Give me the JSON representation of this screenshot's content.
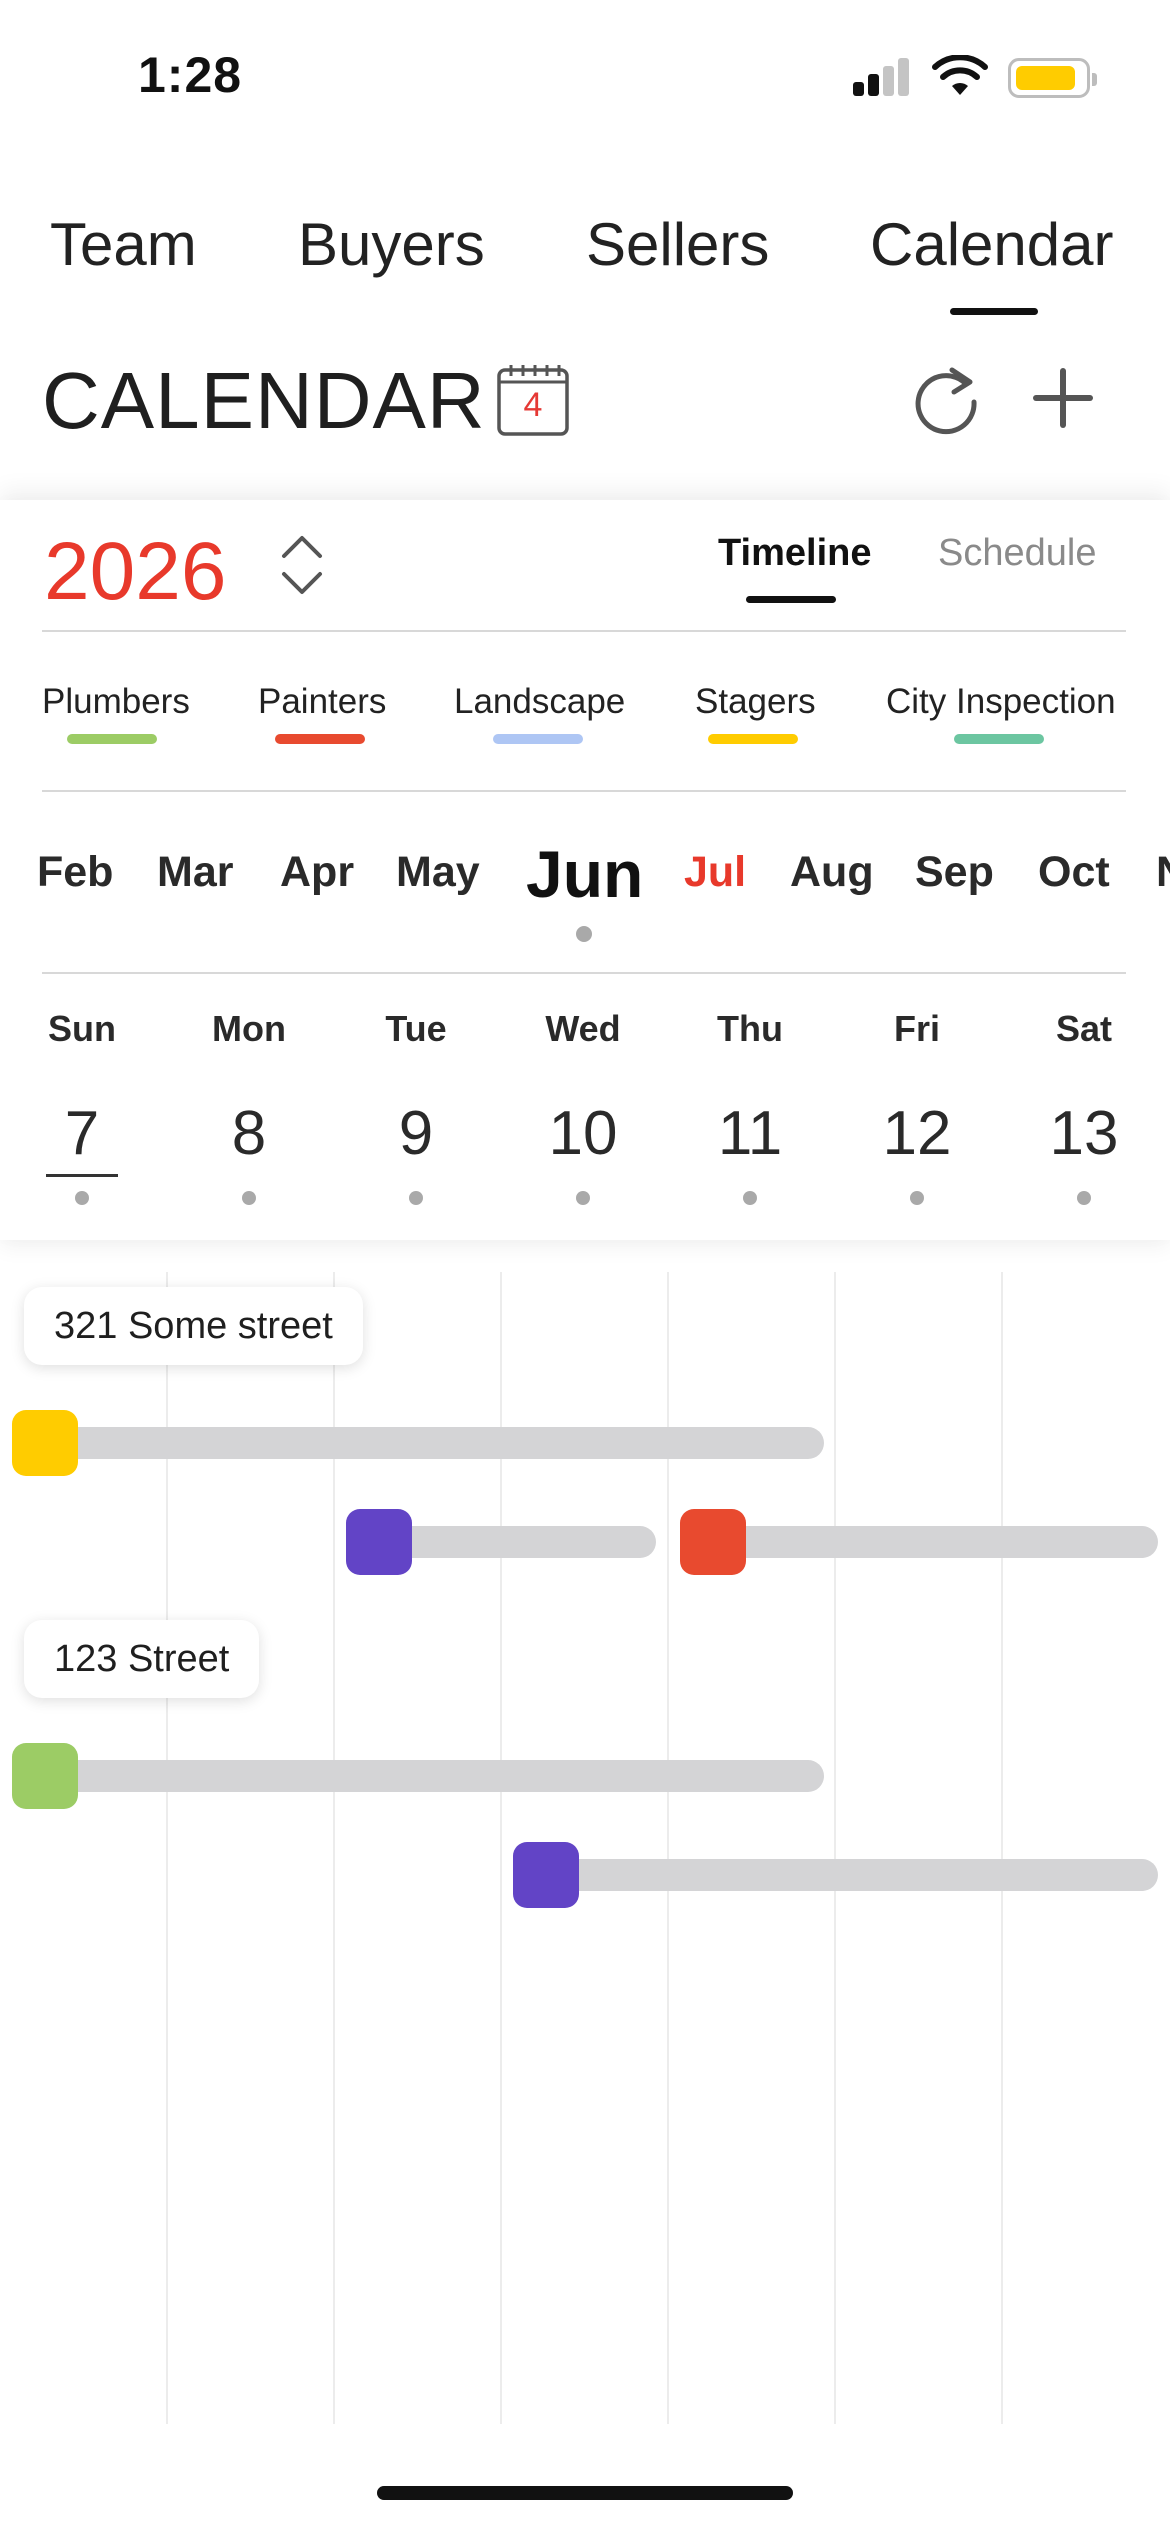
{
  "status_bar": {
    "time": "1:28",
    "battery_color": "#ffcc00"
  },
  "top_tabs": [
    {
      "label": "Team",
      "active": false
    },
    {
      "label": "Buyers",
      "active": false
    },
    {
      "label": "Sellers",
      "active": false
    },
    {
      "label": "Calendar",
      "active": true
    }
  ],
  "header": {
    "title": "CALENDAR",
    "calendar_icon_number": "4",
    "icons": [
      "calendar-icon",
      "refresh-icon",
      "plus-icon"
    ]
  },
  "year_selector": {
    "year": "2026",
    "icon": "chevron-up-down-icon"
  },
  "view_tabs": [
    {
      "label": "Timeline",
      "active": true
    },
    {
      "label": "Schedule",
      "active": false
    }
  ],
  "categories": [
    {
      "label": "Plumbers",
      "color": "#9ccc65"
    },
    {
      "label": "Painters",
      "color": "#e84a2f"
    },
    {
      "label": "Landscape",
      "color": "#aec6f4"
    },
    {
      "label": "Stagers",
      "color": "#ffcc00"
    },
    {
      "label": "City Inspection",
      "color": "#6cc6a1"
    }
  ],
  "months": {
    "items": [
      "Feb",
      "Mar",
      "Apr",
      "May",
      "Jun",
      "Jul",
      "Aug",
      "Sep",
      "Oct",
      "N"
    ],
    "selected": "Jun",
    "highlighted": "Jul"
  },
  "week": {
    "days": [
      {
        "dow": "Sun",
        "date": "7",
        "selected": true
      },
      {
        "dow": "Mon",
        "date": "8",
        "selected": false
      },
      {
        "dow": "Tue",
        "date": "9",
        "selected": false
      },
      {
        "dow": "Wed",
        "date": "10",
        "selected": false
      },
      {
        "dow": "Thu",
        "date": "11",
        "selected": false
      },
      {
        "dow": "Fri",
        "date": "12",
        "selected": false
      },
      {
        "dow": "Sat",
        "date": "13",
        "selected": false
      }
    ]
  },
  "properties": [
    {
      "name": "321 Some street",
      "tasks": [
        {
          "color": "#ffcc00",
          "start_day": "Sun",
          "end_day": "Thu"
        },
        {
          "color": "#6244c6",
          "start_day": "Tue",
          "end_day": "Wed"
        },
        {
          "color": "#e84a2f",
          "start_day": "Thu",
          "end_day": "Sat"
        }
      ]
    },
    {
      "name": "123 Street",
      "tasks": [
        {
          "color": "#9ccc65",
          "start_day": "Sun",
          "end_day": "Thu"
        },
        {
          "color": "#6244c6",
          "start_day": "Wed",
          "end_day": "Sat"
        }
      ]
    }
  ]
}
